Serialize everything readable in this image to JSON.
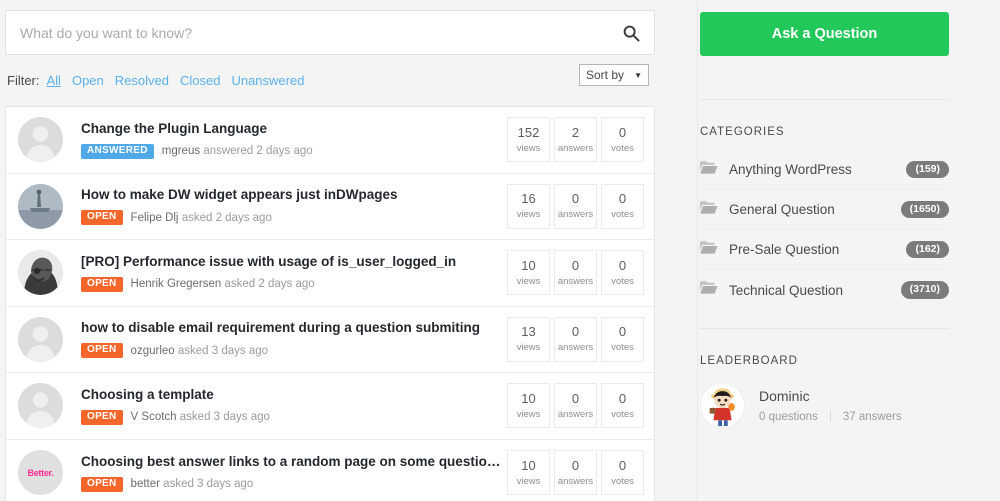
{
  "search": {
    "placeholder": "What do you want to know?",
    "value": "",
    "icon": "search-icon"
  },
  "filter": {
    "label": "Filter:",
    "links": [
      {
        "label": "All",
        "active": true
      },
      {
        "label": "Open",
        "active": false
      },
      {
        "label": "Resolved",
        "active": false
      },
      {
        "label": "Closed",
        "active": false
      },
      {
        "label": "Unanswered",
        "active": false
      }
    ],
    "sort": {
      "label": "Sort by",
      "caret": "▼"
    }
  },
  "questions": [
    {
      "title": "Change the Plugin Language",
      "status": "ANSWERED",
      "status_type": "answered",
      "author": "mgreus",
      "meta": "answered 2 days ago",
      "views": "152",
      "views_label": "views",
      "answers": "2",
      "answers_label": "answers",
      "votes": "0",
      "votes_label": "votes",
      "avatar": "default-person-avatar"
    },
    {
      "title": "How to make DW widget appears just inDWpages",
      "status": "OPEN",
      "status_type": "open",
      "author": "Felipe Dlj",
      "meta": "asked 2 days ago",
      "views": "16",
      "views_label": "views",
      "answers": "0",
      "answers_label": "answers",
      "votes": "0",
      "votes_label": "votes",
      "avatar": "statue-photo-avatar"
    },
    {
      "title": "[PRO] Performance issue with usage of is_user_logged_in",
      "status": "OPEN",
      "status_type": "open",
      "author": "Henrik Gregersen",
      "meta": "asked 2 days ago",
      "views": "10",
      "views_label": "views",
      "answers": "0",
      "answers_label": "answers",
      "votes": "0",
      "votes_label": "votes",
      "avatar": "man-portrait-avatar"
    },
    {
      "title": "how to disable email requirement during a question submiting",
      "status": "OPEN",
      "status_type": "open",
      "author": "ozgurleo",
      "meta": "asked 3 days ago",
      "views": "13",
      "views_label": "views",
      "answers": "0",
      "answers_label": "answers",
      "votes": "0",
      "votes_label": "votes",
      "avatar": "default-person-avatar"
    },
    {
      "title": "Choosing a template",
      "status": "OPEN",
      "status_type": "open",
      "author": "V Scotch",
      "meta": "asked 3 days ago",
      "views": "10",
      "views_label": "views",
      "answers": "0",
      "answers_label": "answers",
      "votes": "0",
      "votes_label": "votes",
      "avatar": "default-person-avatar"
    },
    {
      "title": "Choosing best answer links to a random page on some questions.",
      "status": "OPEN",
      "status_type": "open",
      "author": "better",
      "meta": "asked 3 days ago",
      "views": "10",
      "views_label": "views",
      "answers": "0",
      "answers_label": "answers",
      "votes": "0",
      "votes_label": "votes",
      "avatar": "better-logo-avatar",
      "avatar_text": "Better."
    }
  ],
  "sidebar": {
    "ask_button": "Ask a Question",
    "categories_title": "CATEGORIES",
    "categories": [
      {
        "name": "Anything WordPress",
        "count": "(159)"
      },
      {
        "name": "General Question",
        "count": "(1650)"
      },
      {
        "name": "Pre-Sale Question",
        "count": "(162)"
      },
      {
        "name": "Technical Question",
        "count": "(3710)"
      }
    ],
    "leaderboard_title": "LEADERBOARD",
    "leaders": [
      {
        "name": "Dominic",
        "questions": "0 questions",
        "answers": "37 answers",
        "avatar": "cartoon-character-avatar"
      }
    ]
  },
  "colors": {
    "accent_green": "#22c95a",
    "badge_open": "#f4662a",
    "badge_answered": "#4fa8e8",
    "link_blue": "#5bb1ee",
    "count_pill": "#7b7b7b",
    "page_bg": "#f4f4f4"
  }
}
